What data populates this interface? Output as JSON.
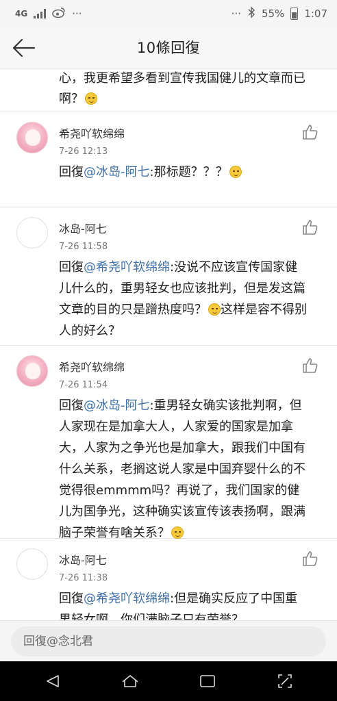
{
  "status_bar": {
    "network": "4G",
    "weibo_icon": "weibo-icon",
    "more": "···",
    "more_right": "···",
    "battery_percent": "55%",
    "time": "1:07"
  },
  "header": {
    "title": "10條回復"
  },
  "partial_comment": {
    "line1": "心，我更希望多看到宣传我国健儿的文章而已",
    "line2": "啊？"
  },
  "comments": [
    {
      "user": "希尧吖软绵绵",
      "time": "7-26 12:13",
      "prefix": "回復",
      "mention": "@冰岛-阿七",
      "text": ":那标题？？？"
    },
    {
      "user": "冰岛-阿七",
      "time": "7-26 11:58",
      "prefix": "回復",
      "mention": "@希尧吖软绵绵",
      "text": ":没说不应该宣传国家健儿什么的，重男轻女也应该批判，但是发这篇文章的目的只是蹭热度吗？",
      "text2": "这样是容不得别人的好么？"
    },
    {
      "user": "希尧吖软绵绵",
      "time": "7-26 11:54",
      "prefix": "回復",
      "mention": "@冰岛-阿七",
      "text": ":重男轻女确实该批判啊，但人家现在是加拿大人，人家爱的国家是加拿大，人家为之争光也是加拿大，跟我们中国有什么关系，老搁这说人家是中国弃婴什么的不觉得很emmmm吗？再说了，我们国家的健儿为国争光，这种确实该宣传该表扬啊，跟满脑子荣誉有啥关系？"
    },
    {
      "user": "冰岛-阿七",
      "time": "7-26 11:38",
      "prefix": "回復",
      "mention": "@希尧吖软绵绵",
      "text": ":但是确实反应了中国重男轻女啊，你们满脑子只有荣誉？"
    }
  ],
  "reply": {
    "placeholder": "回復@念北君"
  },
  "colors": {
    "mention": "#3e6fa8",
    "nav_bar": "#000000",
    "header_bg": "#f7f7f7"
  }
}
